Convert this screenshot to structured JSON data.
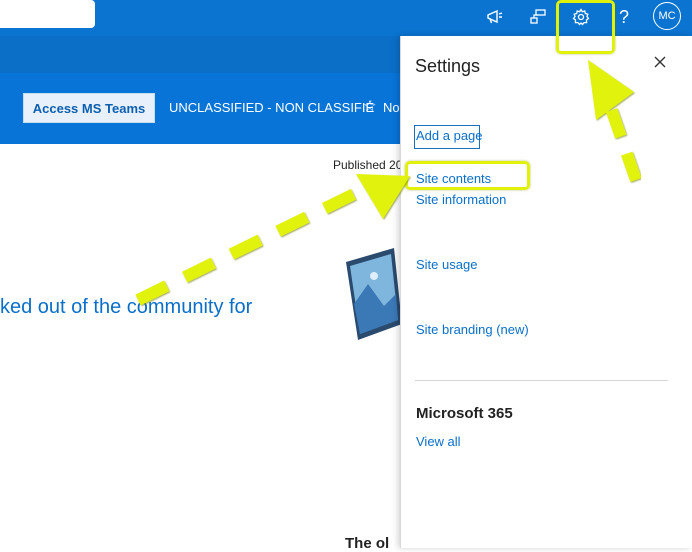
{
  "topbar": {
    "avatar_initials": "MC",
    "help_label": "?",
    "icons": [
      "megaphone-icon",
      "org-chart-icon",
      "gear-icon",
      "help-icon"
    ]
  },
  "commandbar": {
    "teams_button_label": "Access MS Teams",
    "classification": "UNCLASSIFIED - NON CLASSIFIÉ",
    "follow_label_partial": "No"
  },
  "content": {
    "published_partial": "Published 20",
    "headline_partial": "ked out of the community for",
    "bottom_partial": "The ol"
  },
  "settings_panel": {
    "title": "Settings",
    "links": [
      "Add a page",
      "Site contents",
      "Site information",
      "Site usage",
      "Site branding (new)"
    ],
    "section_title": "Microsoft 365",
    "view_all": "View all"
  },
  "colors": {
    "topbar": "#0a74d0",
    "commandbar": "#0874d8",
    "link": "#0b6fc8",
    "highlight": "#e1f20a"
  }
}
